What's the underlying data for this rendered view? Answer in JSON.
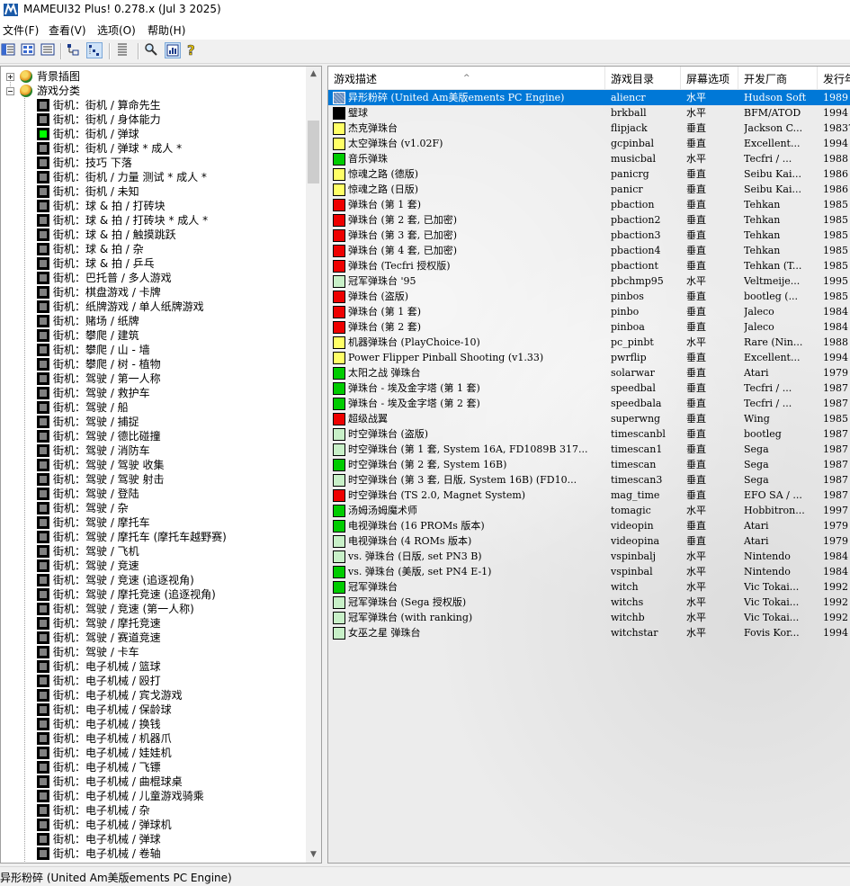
{
  "window": {
    "title": "MAMEUI32 Plus! 0.278.x (Jul  3 2025)"
  },
  "menu": [
    "文件(F)",
    "查看(V)",
    "选项(O)",
    "帮助(H)"
  ],
  "toolbar": {
    "buttons": [
      "folder-view-icon",
      "list-large-icon",
      "list-small-icon",
      "details-icon",
      "grouped-icon",
      "tree-icon",
      "properties-icon",
      "search-icon",
      "info-icon",
      "help-icon"
    ]
  },
  "tree": {
    "roots": [
      {
        "label": "背景插图",
        "expander": "plus"
      },
      {
        "label": "游戏分类",
        "expander": "minus"
      }
    ],
    "items": [
      {
        "label": "街机：街机 / 算命先生",
        "color": "gray"
      },
      {
        "label": "街机：街机 / 身体能力",
        "color": "gray"
      },
      {
        "label": "街机：街机 / 弹球",
        "color": "green"
      },
      {
        "label": "街机：街机 / 弹球 * 成人 *",
        "color": "gray"
      },
      {
        "label": "街机：技巧 下落",
        "color": "gray"
      },
      {
        "label": "街机：街机 / 力量 测试 * 成人 *",
        "color": "gray"
      },
      {
        "label": "街机：街机 / 未知",
        "color": "gray"
      },
      {
        "label": "街机：球 & 拍 / 打砖块",
        "color": "gray"
      },
      {
        "label": "街机：球 & 拍 / 打砖块 * 成人 *",
        "color": "gray"
      },
      {
        "label": "街机：球 & 拍 / 触摸跳跃",
        "color": "gray"
      },
      {
        "label": "街机：球 & 拍 / 杂",
        "color": "gray"
      },
      {
        "label": "街机：球 & 拍 / 乒乓",
        "color": "gray"
      },
      {
        "label": "街机：巴托普 / 多人游戏",
        "color": "gray"
      },
      {
        "label": "街机：棋盘游戏 / 卡牌",
        "color": "gray"
      },
      {
        "label": "街机：纸牌游戏 / 单人纸牌游戏",
        "color": "gray"
      },
      {
        "label": "街机：赌场 / 纸牌",
        "color": "gray"
      },
      {
        "label": "街机：攀爬 / 建筑",
        "color": "gray"
      },
      {
        "label": "街机：攀爬 / 山 - 墙",
        "color": "gray"
      },
      {
        "label": "街机：攀爬 / 树 - 植物",
        "color": "gray"
      },
      {
        "label": "街机：驾驶 / 第一人称",
        "color": "gray"
      },
      {
        "label": "街机：驾驶 / 救护车",
        "color": "gray"
      },
      {
        "label": "街机：驾驶 / 船",
        "color": "gray"
      },
      {
        "label": "街机：驾驶 / 捕捉",
        "color": "gray"
      },
      {
        "label": "街机：驾驶 / 德比碰撞",
        "color": "gray"
      },
      {
        "label": "街机：驾驶 / 消防车",
        "color": "gray"
      },
      {
        "label": "街机：驾驶 / 驾驶 收集",
        "color": "gray"
      },
      {
        "label": "街机：驾驶 / 驾驶 射击",
        "color": "gray"
      },
      {
        "label": "街机：驾驶 / 登陆",
        "color": "gray"
      },
      {
        "label": "街机：驾驶 / 杂",
        "color": "gray"
      },
      {
        "label": "街机：驾驶 / 摩托车",
        "color": "gray"
      },
      {
        "label": "街机：驾驶 / 摩托车 (摩托车越野赛)",
        "color": "gray"
      },
      {
        "label": "街机：驾驶 / 飞机",
        "color": "gray"
      },
      {
        "label": "街机：驾驶 / 竞速",
        "color": "gray"
      },
      {
        "label": "街机：驾驶 / 竞速 (追逐视角)",
        "color": "gray"
      },
      {
        "label": "街机：驾驶 / 摩托竞速 (追逐视角)",
        "color": "gray"
      },
      {
        "label": "街机：驾驶 / 竞速 (第一人称)",
        "color": "gray"
      },
      {
        "label": "街机：驾驶 / 摩托竞速",
        "color": "gray"
      },
      {
        "label": "街机：驾驶 / 赛道竞速",
        "color": "gray"
      },
      {
        "label": "街机：驾驶 / 卡车",
        "color": "gray"
      },
      {
        "label": "街机：电子机械 / 篮球",
        "color": "gray"
      },
      {
        "label": "街机：电子机械 / 殴打",
        "color": "gray"
      },
      {
        "label": "街机：电子机械 / 宾戈游戏",
        "color": "gray"
      },
      {
        "label": "街机：电子机械 / 保龄球",
        "color": "gray"
      },
      {
        "label": "街机：电子机械 / 换钱",
        "color": "gray"
      },
      {
        "label": "街机：电子机械 / 机器爪",
        "color": "gray"
      },
      {
        "label": "街机：电子机械 / 娃娃机",
        "color": "gray"
      },
      {
        "label": "街机：电子机械 / 飞镖",
        "color": "gray"
      },
      {
        "label": "街机：电子机械 / 曲棍球桌",
        "color": "gray"
      },
      {
        "label": "街机：电子机械 / 儿童游戏骑乘",
        "color": "gray"
      },
      {
        "label": "街机：电子机械 / 杂",
        "color": "gray"
      },
      {
        "label": "街机：电子机械 / 弹球机",
        "color": "gray"
      },
      {
        "label": "街机：电子机械 / 弹球",
        "color": "gray"
      },
      {
        "label": "街机：电子机械 / 卷轴",
        "color": "gray"
      }
    ]
  },
  "list": {
    "columns": [
      "游戏描述",
      "游戏目录",
      "屏幕选项",
      "开发厂商",
      "发行年"
    ],
    "rows": [
      {
        "desc": "异形粉碎 (United Am美版ements PC Engine)",
        "dir": "aliencr",
        "screen": "水平",
        "maker": "Hudson Soft",
        "year": "1989",
        "status": "selected"
      },
      {
        "desc": "璧球",
        "dir": "brkball",
        "screen": "水平",
        "maker": "BFM/ATOD",
        "year": "1994",
        "status": "black"
      },
      {
        "desc": "杰克弹珠台",
        "dir": "flipjack",
        "screen": "垂直",
        "maker": "Jackson C...",
        "year": "1983?",
        "status": "yellow"
      },
      {
        "desc": "太空弹珠台 (v1.02F)",
        "dir": "gcpinbal",
        "screen": "垂直",
        "maker": "Excellent...",
        "year": "1994",
        "status": "yellow"
      },
      {
        "desc": "音乐弹珠",
        "dir": "musicbal",
        "screen": "水平",
        "maker": "Tecfri / ...",
        "year": "1988",
        "status": "green"
      },
      {
        "desc": "惊魂之路 (德版)",
        "dir": "panicrg",
        "screen": "垂直",
        "maker": "Seibu Kai...",
        "year": "1986",
        "status": "yellow"
      },
      {
        "desc": "惊魂之路 (日版)",
        "dir": "panicr",
        "screen": "垂直",
        "maker": "Seibu Kai...",
        "year": "1986",
        "status": "yellow"
      },
      {
        "desc": "弹珠台 (第 1 套)",
        "dir": "pbaction",
        "screen": "垂直",
        "maker": "Tehkan",
        "year": "1985",
        "status": "red"
      },
      {
        "desc": "弹珠台 (第 2 套, 已加密)",
        "dir": "pbaction2",
        "screen": "垂直",
        "maker": "Tehkan",
        "year": "1985",
        "status": "red"
      },
      {
        "desc": "弹珠台 (第 3 套, 已加密)",
        "dir": "pbaction3",
        "screen": "垂直",
        "maker": "Tehkan",
        "year": "1985",
        "status": "red"
      },
      {
        "desc": "弹珠台 (第 4 套, 已加密)",
        "dir": "pbaction4",
        "screen": "垂直",
        "maker": "Tehkan",
        "year": "1985",
        "status": "red"
      },
      {
        "desc": "弹珠台 (Tecfri 授权版)",
        "dir": "pbactiont",
        "screen": "垂直",
        "maker": "Tehkan (T...",
        "year": "1985",
        "status": "red"
      },
      {
        "desc": "冠军弹珠台 '95",
        "dir": "pbchmp95",
        "screen": "水平",
        "maker": "Veltmeije...",
        "year": "1995",
        "status": "lightgreen"
      },
      {
        "desc": "弹珠台 (盗版)",
        "dir": "pinbos",
        "screen": "垂直",
        "maker": "bootleg (...",
        "year": "1985",
        "status": "red"
      },
      {
        "desc": "弹珠台 (第 1 套)",
        "dir": "pinbo",
        "screen": "垂直",
        "maker": "Jaleco",
        "year": "1984",
        "status": "red"
      },
      {
        "desc": "弹珠台 (第 2 套)",
        "dir": "pinboa",
        "screen": "垂直",
        "maker": "Jaleco",
        "year": "1984",
        "status": "red"
      },
      {
        "desc": "机器弹珠台 (PlayChoice-10)",
        "dir": "pc_pinbt",
        "screen": "水平",
        "maker": "Rare (Nin...",
        "year": "1988",
        "status": "yellow"
      },
      {
        "desc": "Power Flipper Pinball Shooting (v1.33)",
        "dir": "pwrflip",
        "screen": "垂直",
        "maker": "Excellent...",
        "year": "1994",
        "status": "yellow"
      },
      {
        "desc": "太阳之战 弹珠台",
        "dir": "solarwar",
        "screen": "垂直",
        "maker": "Atari",
        "year": "1979",
        "status": "green"
      },
      {
        "desc": "弹珠台 - 埃及金字塔 (第 1 套)",
        "dir": "speedbal",
        "screen": "垂直",
        "maker": "Tecfri / ...",
        "year": "1987",
        "status": "green"
      },
      {
        "desc": "弹珠台 - 埃及金字塔 (第 2 套)",
        "dir": "speedbala",
        "screen": "垂直",
        "maker": "Tecfri / ...",
        "year": "1987",
        "status": "green"
      },
      {
        "desc": "超级战翼",
        "dir": "superwng",
        "screen": "垂直",
        "maker": "Wing",
        "year": "1985",
        "status": "red"
      },
      {
        "desc": "时空弹珠台 (盗版)",
        "dir": "timescanbl",
        "screen": "垂直",
        "maker": "bootleg",
        "year": "1987",
        "status": "lightgreen"
      },
      {
        "desc": "时空弹珠台 (第 1 套, System 16A, FD1089B 317...",
        "dir": "timescan1",
        "screen": "垂直",
        "maker": "Sega",
        "year": "1987",
        "status": "lightgreen"
      },
      {
        "desc": "时空弹珠台 (第 2 套, System 16B)",
        "dir": "timescan",
        "screen": "垂直",
        "maker": "Sega",
        "year": "1987",
        "status": "green"
      },
      {
        "desc": "时空弹珠台 (第 3 套, 日版, System 16B) (FD10...",
        "dir": "timescan3",
        "screen": "垂直",
        "maker": "Sega",
        "year": "1987",
        "status": "lightgreen"
      },
      {
        "desc": "时空弹珠台 (TS 2.0, Magnet System)",
        "dir": "mag_time",
        "screen": "垂直",
        "maker": "EFO SA / ...",
        "year": "1987",
        "status": "red"
      },
      {
        "desc": "汤姆汤姆魔术师",
        "dir": "tomagic",
        "screen": "水平",
        "maker": "Hobbitron...",
        "year": "1997",
        "status": "green"
      },
      {
        "desc": "电视弹珠台 (16 PROMs 版本)",
        "dir": "videopin",
        "screen": "垂直",
        "maker": "Atari",
        "year": "1979",
        "status": "green"
      },
      {
        "desc": "电视弹珠台 (4 ROMs 版本)",
        "dir": "videopina",
        "screen": "垂直",
        "maker": "Atari",
        "year": "1979",
        "status": "lightgreen"
      },
      {
        "desc": "vs. 弹珠台 (日版, set PN3 B)",
        "dir": "vspinbalj",
        "screen": "水平",
        "maker": "Nintendo",
        "year": "1984",
        "status": "lightgreen"
      },
      {
        "desc": "vs. 弹珠台 (美版, set PN4 E-1)",
        "dir": "vspinbal",
        "screen": "水平",
        "maker": "Nintendo",
        "year": "1984",
        "status": "green"
      },
      {
        "desc": "冠军弹珠台",
        "dir": "witch",
        "screen": "水平",
        "maker": "Vic Tokai...",
        "year": "1992",
        "status": "green"
      },
      {
        "desc": "冠军弹珠台 (Sega 授权版)",
        "dir": "witchs",
        "screen": "水平",
        "maker": "Vic Tokai...",
        "year": "1992",
        "status": "lightgreen"
      },
      {
        "desc": "冠军弹珠台 (with ranking)",
        "dir": "witchb",
        "screen": "水平",
        "maker": "Vic Tokai...",
        "year": "1992",
        "status": "lightgreen"
      },
      {
        "desc": "女巫之星 弹珠台",
        "dir": "witchstar",
        "screen": "水平",
        "maker": "Fovis Kor...",
        "year": "1994",
        "status": "lightgreen"
      }
    ]
  },
  "status_colors": {
    "selected": "#6a8fc0",
    "black": "#000000",
    "yellow": "#ffff66",
    "green": "#00cc00",
    "red": "#ee0000",
    "lightgreen": "#c8f0c8"
  },
  "statusbar": {
    "text": "异形粉碎 (United Am美版ements PC Engine)"
  }
}
